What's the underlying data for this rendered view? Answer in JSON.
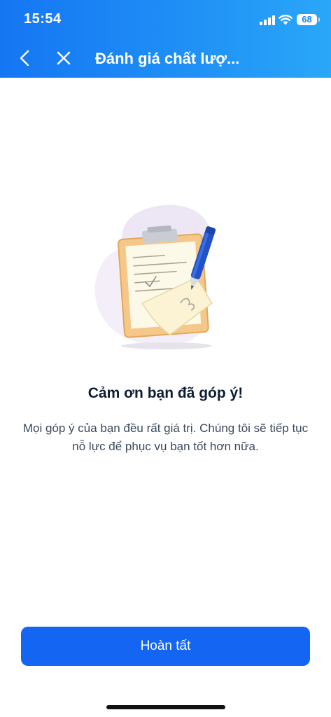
{
  "status_bar": {
    "time": "15:54",
    "battery_level": "68",
    "icons": [
      "signal-icon",
      "wifi-icon",
      "battery-icon"
    ]
  },
  "nav": {
    "title": "Đánh giá chất lượ...",
    "icons": [
      "back-icon",
      "close-icon"
    ]
  },
  "content": {
    "illustration_icon": "clipboard-with-pen-icon",
    "title": "Cảm ơn bạn đã góp ý!",
    "message": "Mọi góp ý của bạn đều rất giá trị. Chúng tôi sẽ tiếp tục nỗ lực để phục vụ bạn tốt hơn nữa."
  },
  "actions": {
    "done_label": "Hoàn tất"
  },
  "colors": {
    "header_gradient_start": "#1576f3",
    "header_gradient_end": "#2aa7f8",
    "primary_button": "#1466f2",
    "title_text": "#0f1d33",
    "body_text": "#3a4a5c"
  }
}
